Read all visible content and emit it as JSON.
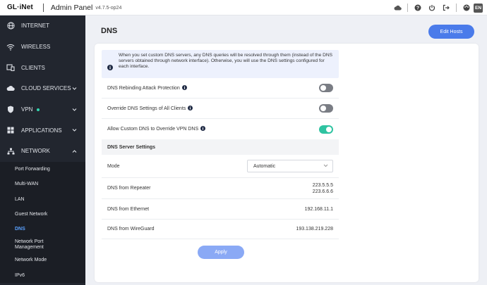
{
  "topbar": {
    "logo": "GL·iNet",
    "title": "Admin Panel",
    "version": "v4.7.5-op24",
    "lang": "EN"
  },
  "sidebar": {
    "items": [
      {
        "label": "INTERNET",
        "icon": "globe-icon"
      },
      {
        "label": "WIRELESS",
        "icon": "wifi-icon"
      },
      {
        "label": "CLIENTS",
        "icon": "devices-icon"
      },
      {
        "label": "CLOUD SERVICES",
        "icon": "cloud-icon"
      },
      {
        "label": "VPN",
        "icon": "shield-icon",
        "status_dot_color": "#33d6b0"
      },
      {
        "label": "APPLICATIONS",
        "icon": "apps-grid-icon"
      },
      {
        "label": "NETWORK",
        "icon": "network-icon"
      }
    ],
    "network_sub": [
      {
        "label": "Port Forwarding"
      },
      {
        "label": "Multi-WAN"
      },
      {
        "label": "LAN"
      },
      {
        "label": "Guest Network"
      },
      {
        "label": "DNS",
        "active": true
      },
      {
        "label": "Network Port Management"
      },
      {
        "label": "Network Mode"
      },
      {
        "label": "IPv6"
      }
    ]
  },
  "page": {
    "title": "DNS",
    "edit_hosts": "Edit Hosts",
    "info": "When you set custom DNS servers, any DNS queries will be resolved through them (instead of the DNS servers obtained through network interface). Otherwise, you will use the DNS settings configured for each interface.",
    "rebinding_label": "DNS Rebinding Attack Protection",
    "rebinding_on": false,
    "override_label": "Override DNS Settings of All Clients",
    "override_on": false,
    "allow_vpn_label": "Allow Custom DNS to Override VPN DNS",
    "allow_vpn_on": true,
    "section_title": "DNS Server Settings",
    "mode_label": "Mode",
    "mode_value": "Automatic",
    "repeater_label": "DNS from Repeater",
    "repeater_values": [
      "223.5.5.5",
      "223.6.6.6"
    ],
    "ethernet_label": "DNS from Ethernet",
    "ethernet_value": "192.168.11.1",
    "wireguard_label": "DNS from WireGuard",
    "wireguard_value": "193.138.219.228",
    "apply": "Apply"
  },
  "colors": {
    "accent": "#4a7bea",
    "sidebar_bg": "#22262f",
    "toggle_on": "#2fc3a1",
    "active_nav": "#5aa1ff"
  }
}
